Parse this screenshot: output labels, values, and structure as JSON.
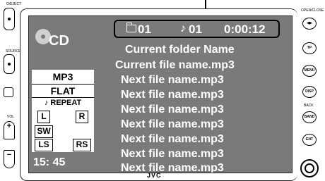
{
  "source": {
    "label": "CD"
  },
  "status": {
    "folder_number": "01",
    "track_number": "01",
    "elapsed": "0:00:12"
  },
  "lines": {
    "current_folder": "Current folder Name",
    "current_file": "Current file name.mp3",
    "next_files": [
      "Next file name.mp3",
      "Next file name.mp3",
      "Next file name.mp3",
      "Next file name.mp3",
      "Next file name.mp3",
      "Next file name.mp3",
      "Next file name.mp3"
    ]
  },
  "info": {
    "format": "MP3",
    "eq": "FLAT",
    "repeat": "REPEAT",
    "speakers": {
      "l": "L",
      "r": "R",
      "sw": "SW",
      "ls": "LS",
      "rs": "RS"
    }
  },
  "clock": "15: 45",
  "brand": "JVC",
  "buttons": {
    "left": [
      "O/EJECT",
      "SOURCE",
      "VOL"
    ],
    "right": [
      "OPEN/CLOSE",
      "TP",
      "MENU",
      "DISP",
      "BACK",
      "BAND",
      "ENT"
    ]
  },
  "icons": {
    "disc": "cd-disc-icon",
    "folder": "folder-icon",
    "note": "music-note-icon",
    "repeat_note": "music-note-icon"
  }
}
